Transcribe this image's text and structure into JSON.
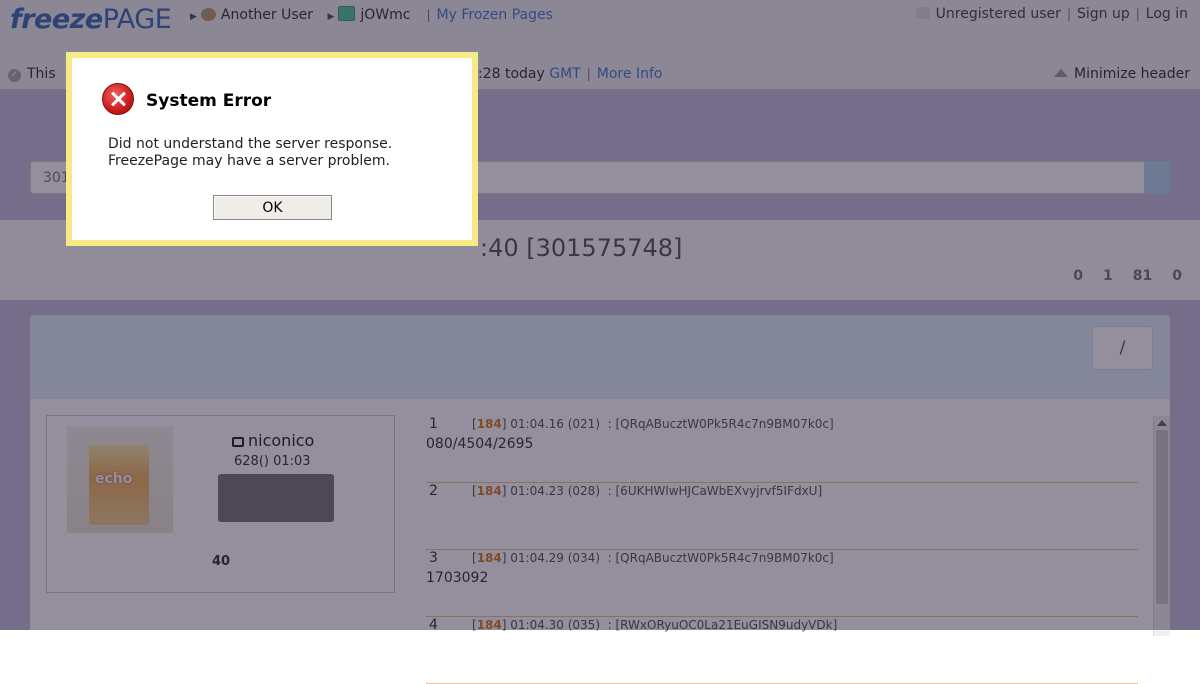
{
  "header": {
    "logo_part1": "freeze",
    "logo_part2": "PAGE",
    "breadcrumb": [
      "Another User",
      "jOWmc"
    ],
    "my_frozen_pages": "My Frozen Pages",
    "unregistered_user": "Unregistered user",
    "sign_up": "Sign up",
    "log_in": "Log in",
    "row2_left": "This",
    "row2_time": ":28 today",
    "row2_gmt": "GMT",
    "more_info": "More Info",
    "minimize_header": "Minimize header"
  },
  "page": {
    "search_value": "301",
    "title_fragment": ":40 [301575748]",
    "stats": [
      "0",
      "1",
      "81",
      "0"
    ],
    "slash_button": "/",
    "video": {
      "thumb_text": "echo",
      "provider": "niconico",
      "info": "628() 01:03",
      "count": "40"
    },
    "comments": [
      {
        "num": "1",
        "count": "184",
        "time": "01:04.16 (021)",
        "id": ": [QRqABucztW0Pk5R4c7n9BM07k0c]",
        "text": "080/4504/2695"
      },
      {
        "num": "2",
        "count": "184",
        "time": "01:04.23 (028)",
        "id": ": [6UKHWlwHJCaWbEXvyjrvf5IFdxU]",
        "text": ""
      },
      {
        "num": "3",
        "count": "184",
        "time": "01:04.29 (034)",
        "id": ": [QRqABucztW0Pk5R4c7n9BM07k0c]",
        "text": "1703092"
      },
      {
        "num": "4",
        "count": "184",
        "time": "01:04.30 (035)",
        "id": ": [RWxORyuOC0La21EuGISN9udyVDk]",
        "text": ""
      }
    ]
  },
  "dialog": {
    "title": "System Error",
    "message_line1": "Did not understand the server response.",
    "message_line2": "FreezePage may have a server problem.",
    "ok_label": "OK"
  },
  "colors": {
    "accent_blue": "#4a7bd0",
    "dialog_border": "#f5ea85",
    "error_red": "#c81b1b",
    "comment_count_orange": "#e07a1a",
    "page_band": "#c5bfd8"
  },
  "icons": [
    "user-icon",
    "document-check-icon",
    "error-icon",
    "minimize-arrow-icon",
    "check-circle-icon",
    "tv-icon"
  ]
}
